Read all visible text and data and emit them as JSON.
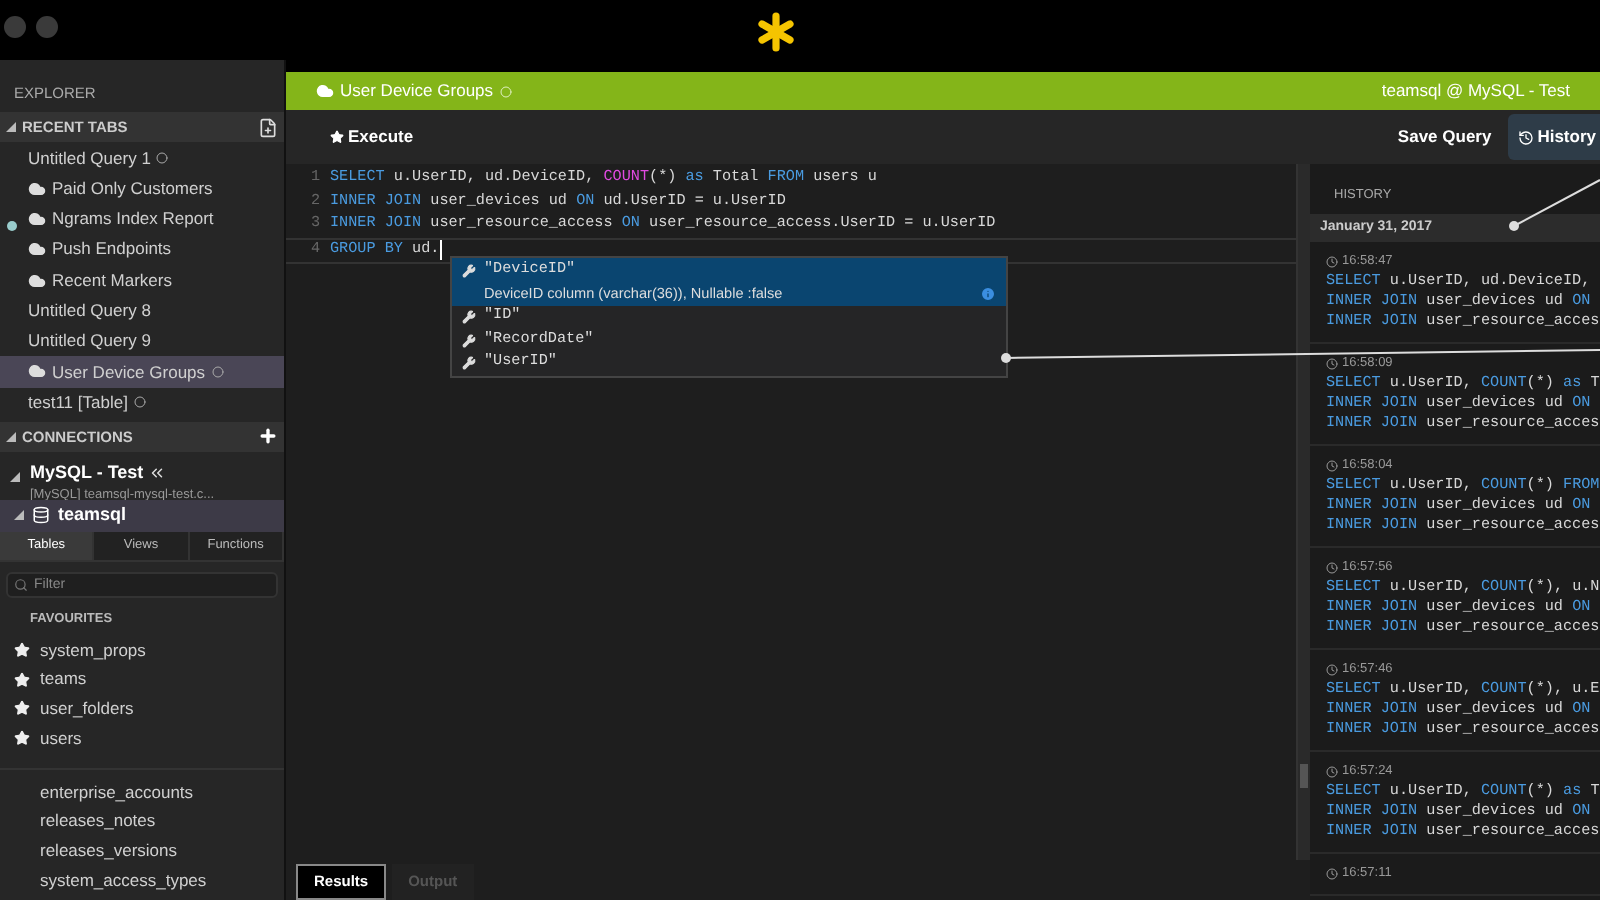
{
  "sidebar": {
    "title": "EXPLORER",
    "recent_tabs": {
      "label": "RECENT TABS",
      "expanded": true,
      "items": [
        {
          "label": "Untitled Query 1",
          "cloud": false,
          "unsaved": true,
          "selected": false
        },
        {
          "label": "Paid Only Customers",
          "cloud": true,
          "unsaved": false,
          "selected": false
        },
        {
          "label": "Ngrams Index Report",
          "cloud": true,
          "unsaved": false,
          "selected": false
        },
        {
          "label": "Push Endpoints",
          "cloud": true,
          "unsaved": false,
          "selected": false
        },
        {
          "label": "Recent Markers",
          "cloud": true,
          "unsaved": false,
          "selected": false
        },
        {
          "label": "Untitled Query 8",
          "cloud": false,
          "unsaved": false,
          "selected": false
        },
        {
          "label": "Untitled Query 9",
          "cloud": false,
          "unsaved": false,
          "selected": false
        },
        {
          "label": "User Device Groups",
          "cloud": true,
          "unsaved": true,
          "selected": true
        },
        {
          "label": "test11 [Table]",
          "cloud": false,
          "unsaved": true,
          "selected": false
        }
      ]
    },
    "connections": {
      "label": "CONNECTIONS",
      "expanded": true,
      "connection": {
        "name": "MySQL - Test",
        "detail": "[MySQL] teamsql-mysql-test.c...",
        "expanded": true
      },
      "database": {
        "name": "teamsql",
        "expanded": true
      },
      "tabs": [
        {
          "label": "Tables",
          "selected": true
        },
        {
          "label": "Views",
          "selected": false
        },
        {
          "label": "Functions",
          "selected": false
        }
      ],
      "filter": {
        "placeholder": "Filter"
      },
      "favourites_label": "FAVOURITES",
      "tables": [
        {
          "name": "system_props",
          "favourite": true
        },
        {
          "name": "teams",
          "favourite": true
        },
        {
          "name": "user_folders",
          "favourite": true
        },
        {
          "name": "users",
          "favourite": true
        },
        {
          "name": "enterprise_accounts",
          "favourite": false
        },
        {
          "name": "releases_notes",
          "favourite": false
        },
        {
          "name": "releases_versions",
          "favourite": false
        },
        {
          "name": "system_access_types",
          "favourite": false
        }
      ]
    }
  },
  "query_tab": {
    "title": "User Device Groups",
    "unsaved": true,
    "connection": "teamsql @ MySQL - Test"
  },
  "toolbar": {
    "execute": "Execute",
    "save": "Save Query",
    "history": {
      "label": "History",
      "selected": true
    }
  },
  "editor": {
    "lines": [
      {
        "number": "1",
        "current": false,
        "tokens": [
          {
            "kind": "keyword",
            "text": "SELECT"
          },
          {
            "kind": "plain",
            "text": " u.UserID, ud.DeviceID, "
          },
          {
            "kind": "function",
            "text": "COUNT"
          },
          {
            "kind": "plain",
            "text": "(*) "
          },
          {
            "kind": "keyword",
            "text": "as"
          },
          {
            "kind": "plain",
            "text": " Total "
          },
          {
            "kind": "keyword",
            "text": "FROM"
          },
          {
            "kind": "plain",
            "text": " users u"
          }
        ]
      },
      {
        "number": "2",
        "current": false,
        "tokens": [
          {
            "kind": "keyword",
            "text": "INNER JOIN"
          },
          {
            "kind": "plain",
            "text": " user_devices ud "
          },
          {
            "kind": "keyword",
            "text": "ON"
          },
          {
            "kind": "plain",
            "text": " ud.UserID = u.UserID"
          }
        ]
      },
      {
        "number": "3",
        "current": false,
        "tokens": [
          {
            "kind": "keyword",
            "text": "INNER JOIN"
          },
          {
            "kind": "plain",
            "text": " user_resource_access "
          },
          {
            "kind": "keyword",
            "text": "ON"
          },
          {
            "kind": "plain",
            "text": " user_resource_access.UserID = u.UserID"
          }
        ]
      },
      {
        "number": "4",
        "current": true,
        "tokens": [
          {
            "kind": "keyword",
            "text": "GROUP BY"
          },
          {
            "kind": "plain",
            "text": " ud."
          }
        ]
      }
    ],
    "suggestions": [
      {
        "label": "\"DeviceID\"",
        "detail": "DeviceID column (varchar(36)), Nullable :false",
        "selected": true
      },
      {
        "label": "\"ID\"",
        "selected": false
      },
      {
        "label": "\"RecordDate\"",
        "selected": false
      },
      {
        "label": "\"UserID\"",
        "selected": false
      }
    ]
  },
  "bottom_tabs": [
    {
      "label": "Results",
      "selected": true
    },
    {
      "label": "Output",
      "selected": false
    }
  ],
  "history": {
    "title": "HISTORY",
    "date": "January 31, 2017",
    "entries": [
      {
        "time": "16:58:47",
        "lines": [
          [
            {
              "kind": "keyword",
              "text": "SELECT"
            },
            {
              "kind": "plain",
              "text": " u.UserID, ud.DeviceID,"
            }
          ],
          [
            {
              "kind": "keyword",
              "text": "INNER JOIN"
            },
            {
              "kind": "plain",
              "text": " user_devices ud "
            },
            {
              "kind": "keyword",
              "text": "ON"
            }
          ],
          [
            {
              "kind": "keyword",
              "text": "INNER JOIN"
            },
            {
              "kind": "plain",
              "text": " user_resource_acces"
            }
          ]
        ]
      },
      {
        "time": "16:58:09",
        "lines": [
          [
            {
              "kind": "keyword",
              "text": "SELECT"
            },
            {
              "kind": "plain",
              "text": " u.UserID, "
            },
            {
              "kind": "keyword",
              "text": "COUNT"
            },
            {
              "kind": "plain",
              "text": "(*) "
            },
            {
              "kind": "keyword",
              "text": "as"
            },
            {
              "kind": "plain",
              "text": " T"
            }
          ],
          [
            {
              "kind": "keyword",
              "text": "INNER JOIN"
            },
            {
              "kind": "plain",
              "text": " user_devices ud "
            },
            {
              "kind": "keyword",
              "text": "ON"
            }
          ],
          [
            {
              "kind": "keyword",
              "text": "INNER JOIN"
            },
            {
              "kind": "plain",
              "text": " user_resource_acces"
            }
          ]
        ]
      },
      {
        "time": "16:58:04",
        "lines": [
          [
            {
              "kind": "keyword",
              "text": "SELECT"
            },
            {
              "kind": "plain",
              "text": " u.UserID, "
            },
            {
              "kind": "keyword",
              "text": "COUNT"
            },
            {
              "kind": "plain",
              "text": "(*) "
            },
            {
              "kind": "keyword",
              "text": "FROM"
            }
          ],
          [
            {
              "kind": "keyword",
              "text": "INNER JOIN"
            },
            {
              "kind": "plain",
              "text": " user_devices ud "
            },
            {
              "kind": "keyword",
              "text": "ON"
            }
          ],
          [
            {
              "kind": "keyword",
              "text": "INNER JOIN"
            },
            {
              "kind": "plain",
              "text": " user_resource_acces"
            }
          ]
        ]
      },
      {
        "time": "16:57:56",
        "lines": [
          [
            {
              "kind": "keyword",
              "text": "SELECT"
            },
            {
              "kind": "plain",
              "text": " u.UserID, "
            },
            {
              "kind": "keyword",
              "text": "COUNT"
            },
            {
              "kind": "plain",
              "text": "(*), u.N"
            }
          ],
          [
            {
              "kind": "keyword",
              "text": "INNER JOIN"
            },
            {
              "kind": "plain",
              "text": " user_devices ud "
            },
            {
              "kind": "keyword",
              "text": "ON"
            }
          ],
          [
            {
              "kind": "keyword",
              "text": "INNER JOIN"
            },
            {
              "kind": "plain",
              "text": " user_resource_acces"
            }
          ]
        ]
      },
      {
        "time": "16:57:46",
        "lines": [
          [
            {
              "kind": "keyword",
              "text": "SELECT"
            },
            {
              "kind": "plain",
              "text": " u.UserID, "
            },
            {
              "kind": "keyword",
              "text": "COUNT"
            },
            {
              "kind": "plain",
              "text": "(*), u.E"
            }
          ],
          [
            {
              "kind": "keyword",
              "text": "INNER JOIN"
            },
            {
              "kind": "plain",
              "text": " user_devices ud "
            },
            {
              "kind": "keyword",
              "text": "ON"
            }
          ],
          [
            {
              "kind": "keyword",
              "text": "INNER JOIN"
            },
            {
              "kind": "plain",
              "text": " user_resource_acces"
            }
          ]
        ]
      },
      {
        "time": "16:57:24",
        "lines": [
          [
            {
              "kind": "keyword",
              "text": "SELECT"
            },
            {
              "kind": "plain",
              "text": " u.UserID, "
            },
            {
              "kind": "keyword",
              "text": "COUNT"
            },
            {
              "kind": "plain",
              "text": "(*) "
            },
            {
              "kind": "keyword",
              "text": "as"
            },
            {
              "kind": "plain",
              "text": " T"
            }
          ],
          [
            {
              "kind": "keyword",
              "text": "INNER JOIN"
            },
            {
              "kind": "plain",
              "text": " user_devices ud "
            },
            {
              "kind": "keyword",
              "text": "ON"
            }
          ],
          [
            {
              "kind": "keyword",
              "text": "INNER JOIN"
            },
            {
              "kind": "plain",
              "text": " user_resource_acces"
            }
          ]
        ]
      },
      {
        "time": "16:57:11"
      }
    ]
  }
}
